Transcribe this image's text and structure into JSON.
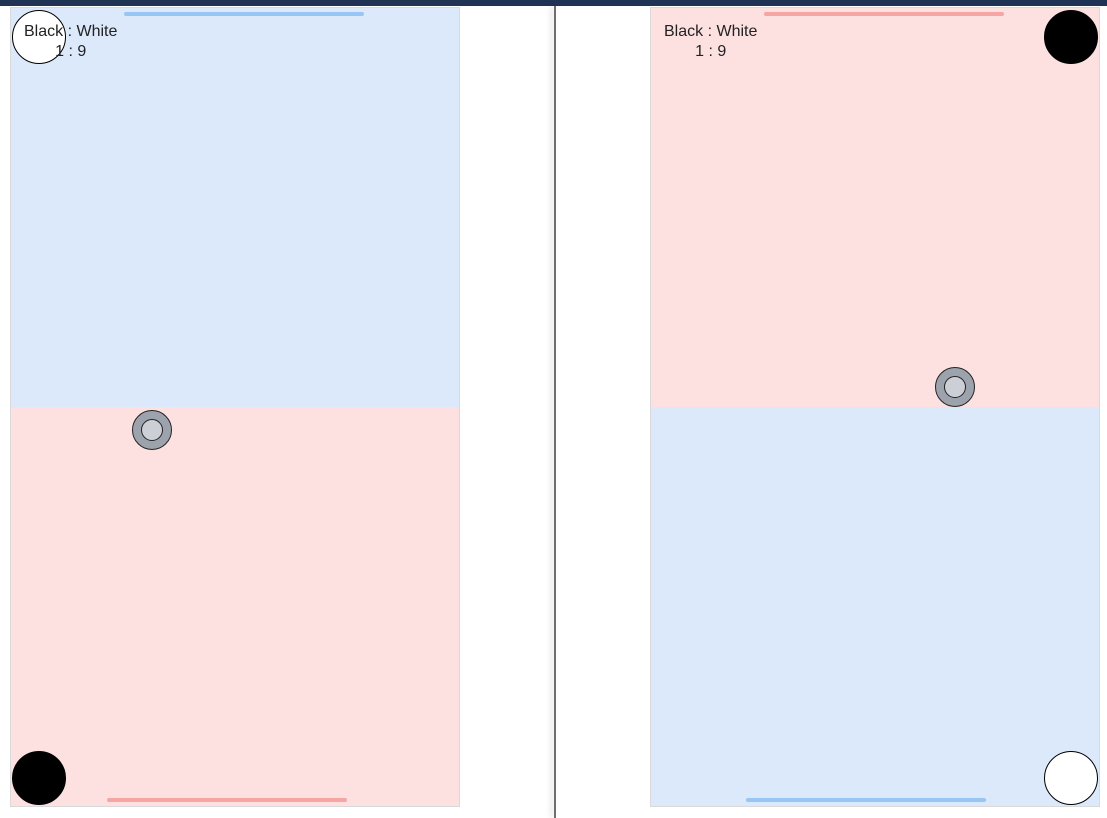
{
  "colors": {
    "blue_zone": "#dbe9fb",
    "red_zone": "#fde1e1",
    "blue_bar": "#98c6f4",
    "red_bar": "#f6a5a5",
    "black_paddle": "#000000",
    "white_paddle": "#ffffff"
  },
  "left_view": {
    "score": {
      "label": "Black : White",
      "values": "1 : 9"
    }
  },
  "right_view": {
    "score": {
      "label": "Black : White",
      "values": "1 : 9"
    }
  }
}
